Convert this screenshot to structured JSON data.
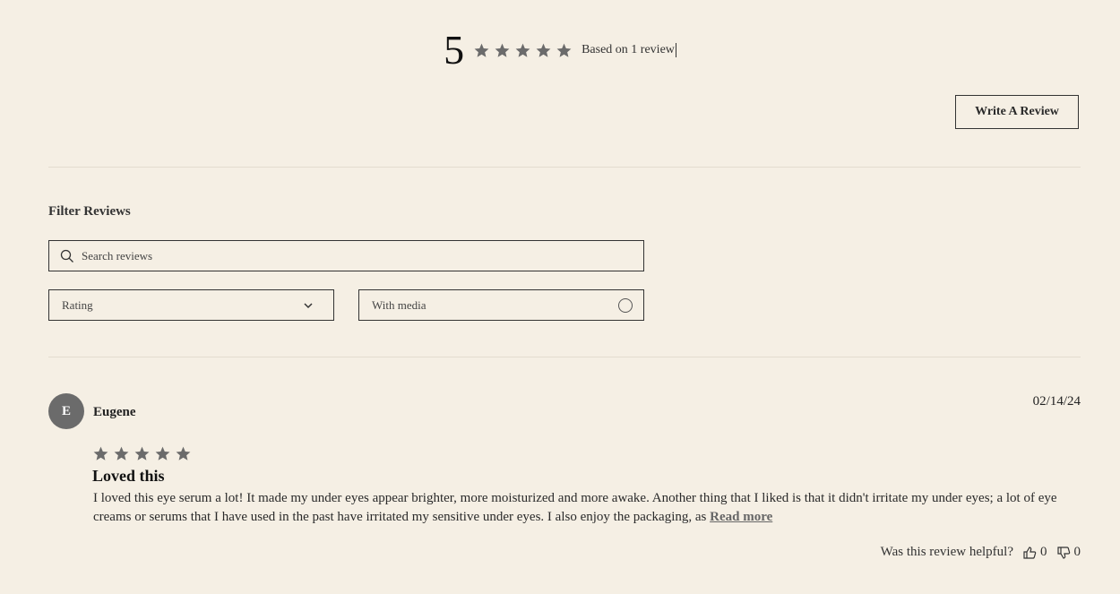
{
  "summary": {
    "average": "5",
    "star_count": 5,
    "based_on": "Based on 1 review"
  },
  "write_review_label": "Write A Review",
  "filters": {
    "title": "Filter Reviews",
    "search_placeholder": "Search reviews",
    "rating_label": "Rating",
    "media_label": "With media"
  },
  "review": {
    "avatar_initial": "E",
    "author": "Eugene",
    "date": "02/14/24",
    "rating": 5,
    "title": "Loved this",
    "body": "I loved this eye serum a lot! It made my under eyes appear brighter, more moisturized and more awake. Another thing that I liked is that it didn't irritate my under eyes; a lot of eye creams or serums that I have used in the past have irritated my sensitive under eyes. I also enjoy the packaging, as",
    "read_more": "Read more",
    "helpful_label": "Was this review helpful?",
    "helpful_yes": "0",
    "helpful_no": "0"
  },
  "colors": {
    "background": "#f5efe4",
    "star": "#6b6b6b",
    "avatar": "#6b6b6b"
  }
}
